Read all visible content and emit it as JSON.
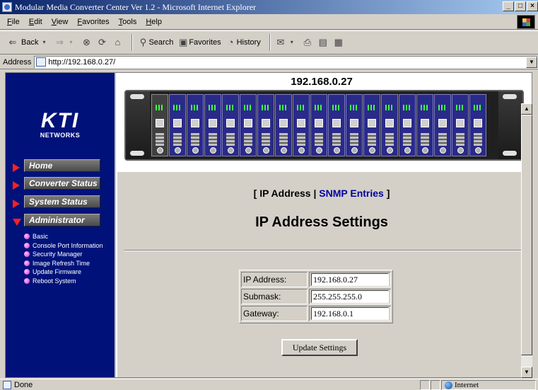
{
  "window": {
    "title": "Modular Media Converter Center Ver 1.2 - Microsoft Internet Explorer",
    "minimize": "_",
    "maximize": "□",
    "close": "×"
  },
  "menu": {
    "items": [
      "File",
      "Edit",
      "View",
      "Favorites",
      "Tools",
      "Help"
    ]
  },
  "toolbar": {
    "back_label": "Back",
    "search_label": "Search",
    "favorites_label": "Favorites",
    "history_label": "History"
  },
  "address": {
    "label": "Address",
    "url": "http://192.168.0.27/"
  },
  "sidebar": {
    "logo_text": "KTI",
    "logo_sub": "NETWORKS",
    "nav": [
      {
        "label": "Home"
      },
      {
        "label": "Converter Status"
      },
      {
        "label": "System Status"
      },
      {
        "label": "Administrator"
      }
    ],
    "subnav": [
      "Basic",
      "Console Port Information",
      "Security Manager",
      "Image Refresh Time",
      "Update Firmware",
      "Reboot System"
    ]
  },
  "device": {
    "ip": "192.168.0.27"
  },
  "tabs": {
    "open_bracket": "[",
    "ip_address": "IP Address",
    "separator": "|",
    "snmp_entries": "SNMP Entries",
    "close_bracket": "]"
  },
  "page": {
    "title": "IP Address Settings"
  },
  "form": {
    "ip_label": "IP Address:",
    "ip_value": "192.168.0.27",
    "submask_label": "Submask:",
    "submask_value": "255.255.255.0",
    "gateway_label": "Gateway:",
    "gateway_value": "192.168.0.1",
    "submit_label": "Update Settings"
  },
  "status": {
    "text": "Done",
    "zone": "Internet"
  }
}
